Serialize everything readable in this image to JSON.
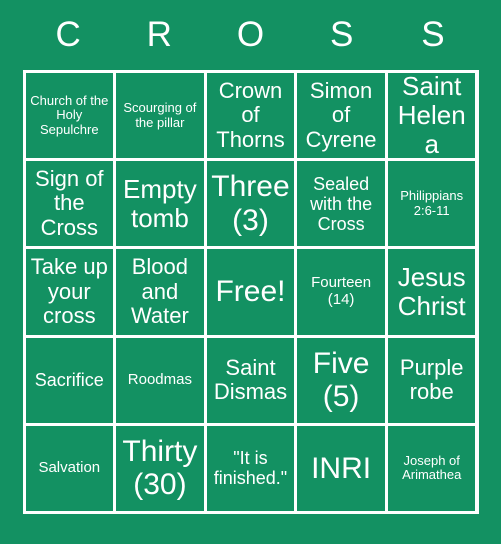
{
  "card": {
    "title_letters": [
      "C",
      "R",
      "O",
      "S",
      "S"
    ],
    "colors": {
      "background": "#139162",
      "cell": "#139162",
      "grid_line": "#ffffff",
      "text": "#ffffff"
    },
    "grid": {
      "columns": 5,
      "rows": 5,
      "free_space_index": 12
    },
    "cells": [
      {
        "text": "Church of the Holy Sepulchre",
        "size": "fs-xs"
      },
      {
        "text": "Scourging of the pillar",
        "size": "fs-xs"
      },
      {
        "text": "Crown of Thorns",
        "size": "fs-l"
      },
      {
        "text": "Simon of Cyrene",
        "size": "fs-l"
      },
      {
        "text": "Saint Helena",
        "size": "fs-xl"
      },
      {
        "text": "Sign of the Cross",
        "size": "fs-l"
      },
      {
        "text": "Empty tomb",
        "size": "fs-xl"
      },
      {
        "text": "Three (3)",
        "size": "fs-xxl"
      },
      {
        "text": "Sealed with the Cross",
        "size": "fs-m"
      },
      {
        "text": "Philippians 2:6-11",
        "size": "fs-xs"
      },
      {
        "text": "Take up your cross",
        "size": "fs-l"
      },
      {
        "text": "Blood and Water",
        "size": "fs-l"
      },
      {
        "text": "Free!",
        "size": "fs-xxl"
      },
      {
        "text": "Fourteen (14)",
        "size": "fs-s"
      },
      {
        "text": "Jesus Christ",
        "size": "fs-xl"
      },
      {
        "text": "Sacrifice",
        "size": "fs-m"
      },
      {
        "text": "Roodmas",
        "size": "fs-s"
      },
      {
        "text": "Saint Dismas",
        "size": "fs-l"
      },
      {
        "text": "Five (5)",
        "size": "fs-xxl"
      },
      {
        "text": "Purple robe",
        "size": "fs-l"
      },
      {
        "text": "Salvation",
        "size": "fs-s"
      },
      {
        "text": "Thirty (30)",
        "size": "fs-xxl"
      },
      {
        "text": "\"It is finished.\"",
        "size": "fs-m"
      },
      {
        "text": "INRI",
        "size": "fs-xxl"
      },
      {
        "text": "Joseph of Arimathea",
        "size": "fs-xs"
      }
    ]
  }
}
